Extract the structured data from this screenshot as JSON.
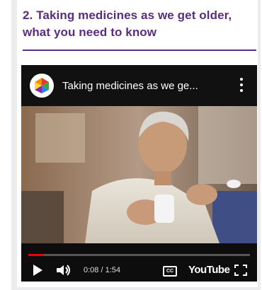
{
  "section": {
    "heading": "2. Taking medicines as we get older, what you need to know"
  },
  "video": {
    "title": "Taking medicines as we ge...",
    "time": "0:08 / 1:54",
    "progress": 0.07,
    "cc_label": "CC",
    "brand": "YouTube",
    "icons": [
      "channel-logo-icon",
      "more-vert-icon",
      "play-icon",
      "volume-icon",
      "captions-icon",
      "fullscreen-icon"
    ]
  },
  "colors": {
    "heading": "#5a2d7f",
    "progress": "#ee0000"
  }
}
